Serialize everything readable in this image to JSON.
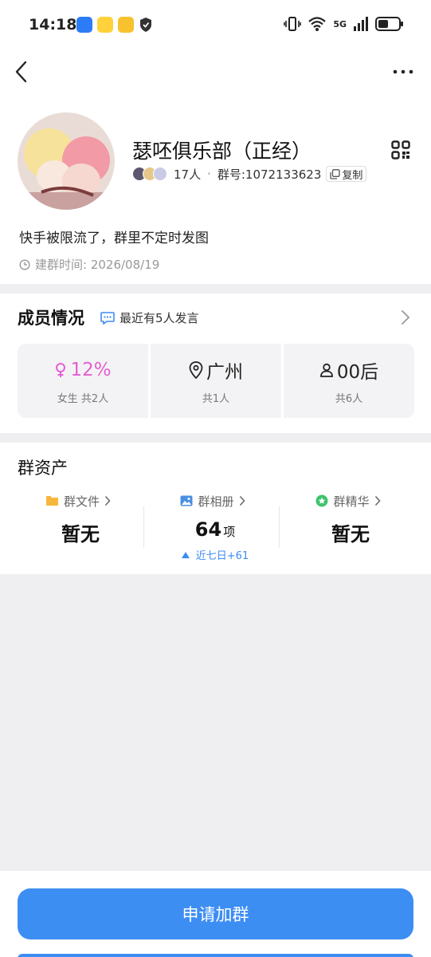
{
  "status_bar": {
    "time": "14:18",
    "network": "5G"
  },
  "group": {
    "name": "瑟呸俱乐部（正经）",
    "member_count": "17人",
    "separator": "·",
    "group_id": "群号:1072133623",
    "copy_label": "复制",
    "intro": "快手被限流了，群里不定时发图",
    "created": "建群时间: 2026/08/19"
  },
  "members": {
    "title": "成员情况",
    "recent": "最近有5人发言",
    "stats": [
      {
        "main": "12%",
        "sub": "女生 共2人"
      },
      {
        "main": "广州",
        "sub": "共1人"
      },
      {
        "main": "00后",
        "sub": "共6人"
      }
    ]
  },
  "assets": {
    "title": "群资产",
    "items": [
      {
        "label": "群文件",
        "value": "暂无",
        "unit": "",
        "trend": ""
      },
      {
        "label": "群相册",
        "value": "64",
        "unit": "项",
        "trend": "近七日+61"
      },
      {
        "label": "群精华",
        "value": "暂无",
        "unit": "",
        "trend": ""
      }
    ]
  },
  "actions": {
    "join_label": "申请加群"
  },
  "colors": {
    "accent": "#3d8ef3",
    "female": "#e35fd3",
    "folder": "#f6b73c",
    "album": "#4a90e2",
    "essence": "#3ec46d"
  }
}
